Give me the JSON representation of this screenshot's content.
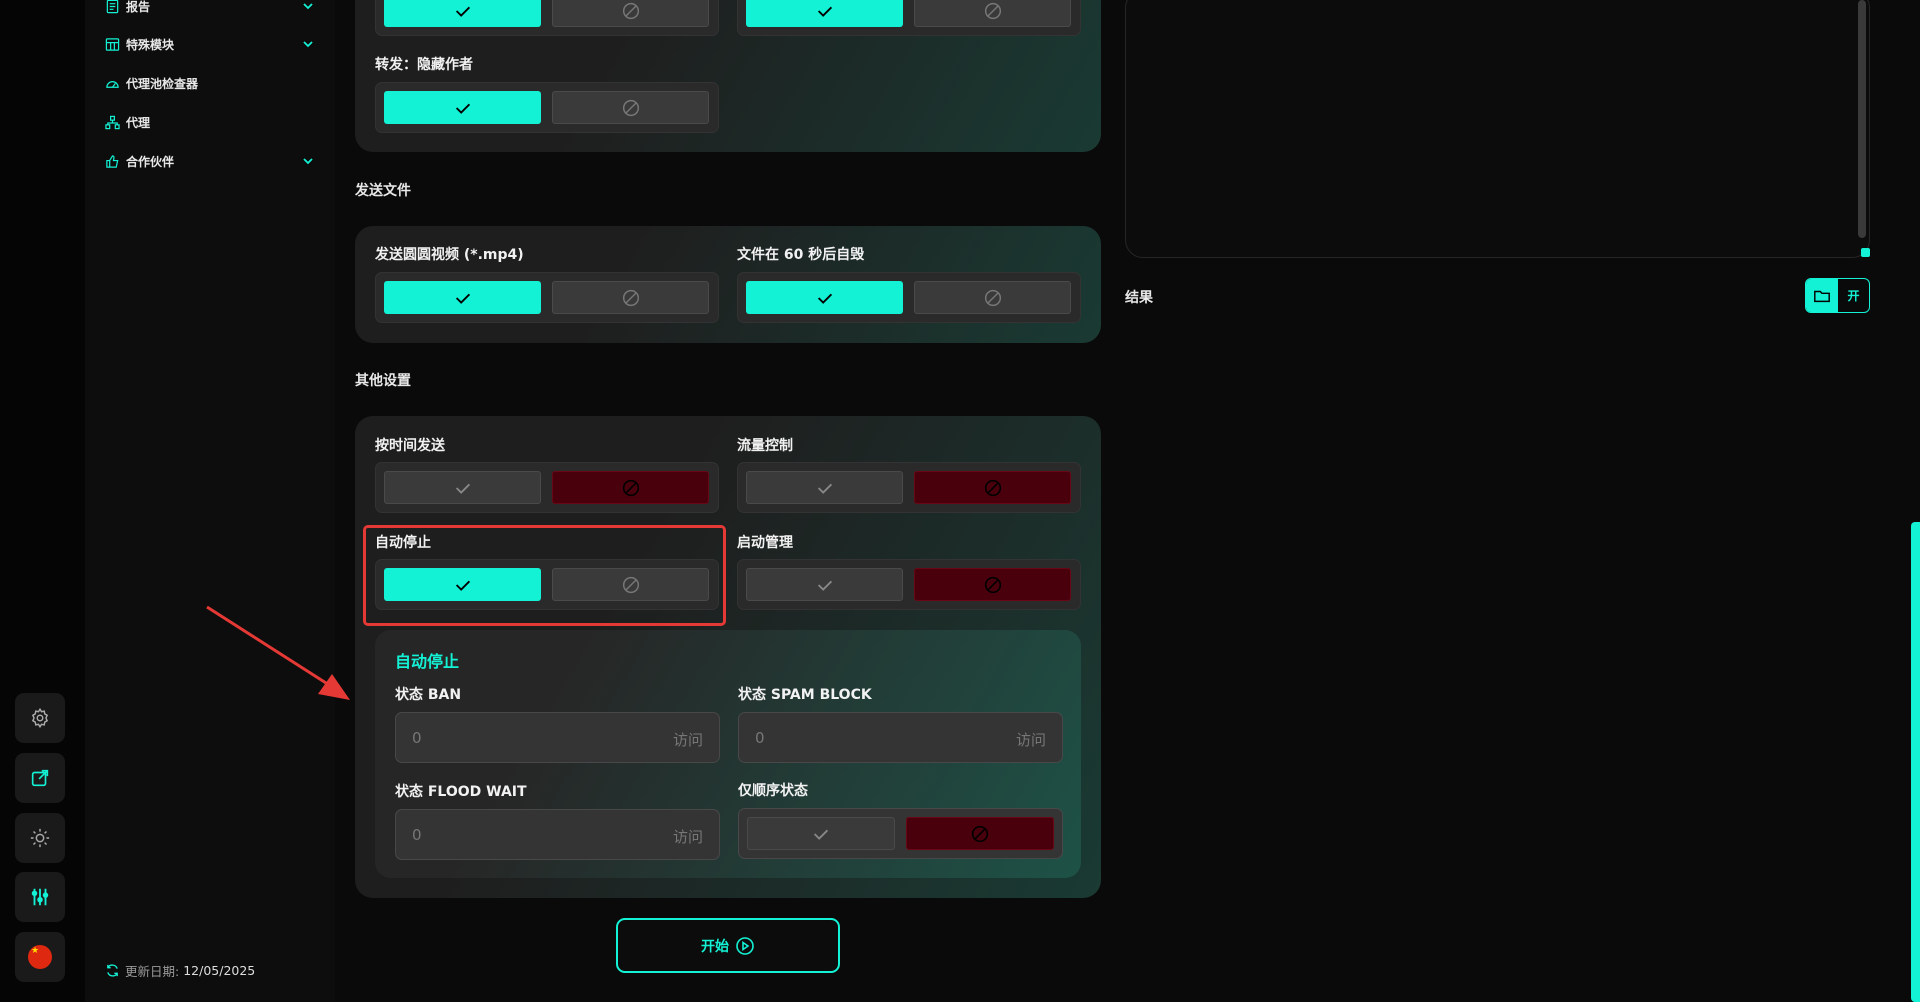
{
  "colors": {
    "accent": "#13f2d4",
    "deny": "#4a000c",
    "highlight": "#e53935"
  },
  "nav": {
    "items": [
      {
        "label": "报告",
        "icon": "report-icon",
        "expandable": true
      },
      {
        "label": "特殊模块",
        "icon": "table-icon",
        "expandable": true
      },
      {
        "label": "代理池检查器",
        "icon": "gauge-icon",
        "expandable": false
      },
      {
        "label": "代理",
        "icon": "network-icon",
        "expandable": false
      },
      {
        "label": "合作伙伴",
        "icon": "thumbs-up-icon",
        "expandable": true
      }
    ],
    "update_label": "更新日期:",
    "update_date": "12/05/2025"
  },
  "rail": [
    "gear-icon",
    "external-link-icon",
    "sun-icon",
    "sliders-icon",
    "china-flag-icon"
  ],
  "sections": {
    "forward": {
      "hide_author_label": "转发：隐藏作者",
      "top_row_states": [
        "on",
        "on"
      ],
      "hide_author_state": "on"
    },
    "send_files": {
      "title": "发送文件",
      "video_note_label": "发送圆圆视频 (*.mp4)",
      "video_note_state": "on",
      "self_destruct_label": "文件在 60 秒后自毁",
      "self_destruct_state": "on"
    },
    "other": {
      "title": "其他设置",
      "schedule_label": "按时间发送",
      "schedule_state": "off",
      "flow_label": "流量控制",
      "flow_state": "off",
      "autostop_label": "自动停止",
      "autostop_state": "on",
      "launch_mgmt_label": "启动管理",
      "launch_mgmt_state": "off"
    },
    "autostop_panel": {
      "title": "自动停止",
      "ban_label": "状态 BAN",
      "ban_value": "0",
      "ban_unit": "访问",
      "spam_label": "状态 SPAM BLOCK",
      "spam_value": "0",
      "spam_unit": "访问",
      "flood_label": "状态 FLOOD WAIT",
      "flood_value": "0",
      "flood_unit": "访问",
      "seq_label": "仅顺序状态",
      "seq_state": "off"
    }
  },
  "start_button": "开始",
  "results": {
    "label": "结果",
    "open_label": "开"
  }
}
